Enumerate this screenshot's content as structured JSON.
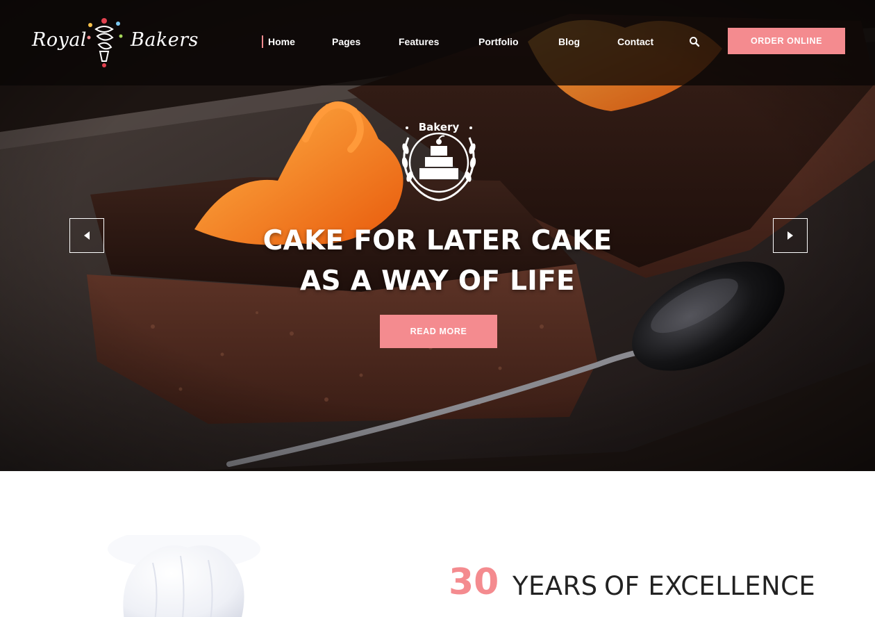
{
  "brand": {
    "name_left": "Royal",
    "name_right": "Bakers",
    "accent_color": "#f48b8f"
  },
  "nav": {
    "items": [
      {
        "label": "Home",
        "active": true
      },
      {
        "label": "Pages",
        "active": false
      },
      {
        "label": "Features",
        "active": false
      },
      {
        "label": "Portfolio",
        "active": false
      },
      {
        "label": "Blog",
        "active": false
      },
      {
        "label": "Contact",
        "active": false
      }
    ],
    "search_icon": "search-icon",
    "order_label": "ORDER ONLINE"
  },
  "slider": {
    "badge_text": "Bakery",
    "headline_line1": "CAKE FOR LATER CAKE",
    "headline_line2": "AS A WAY OF LIFE",
    "cta_label": "READ MORE",
    "prev_icon": "chevron-left-icon",
    "next_icon": "chevron-right-icon"
  },
  "about": {
    "years_number": "30",
    "years_label_a": "YEARS",
    "years_label_b": "OF EXCELLENCE"
  }
}
